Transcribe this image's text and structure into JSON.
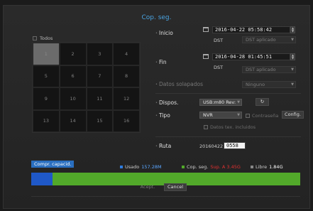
{
  "title": "Cop. seg.",
  "all_label": "Todos",
  "channels": [
    "1",
    "2",
    "3",
    "4",
    "5",
    "6",
    "7",
    "8",
    "9",
    "10",
    "11",
    "12",
    "13",
    "14",
    "15",
    "16"
  ],
  "start": {
    "label": "Inicio",
    "datetime": "2016-04-22 05:58:42",
    "dst_label": "DST",
    "dst_value": "DST aplicado"
  },
  "end": {
    "label": "Fin",
    "datetime": "2016-04-28 01:45:51",
    "dst_label": "DST",
    "dst_value": "DST aplicado"
  },
  "overlap": {
    "label": "Datos solapados",
    "value": "Ninguno"
  },
  "device": {
    "label": "Dispos.",
    "value": "USB:m80 Rev:"
  },
  "type": {
    "label": "Tipo",
    "value": "NVR",
    "password_label": "Contraseña",
    "config_label": "Config.",
    "text_data_label": "Datos tex. incluidos"
  },
  "path": {
    "label": "Ruta",
    "prefix": "20160422",
    "value": "0558"
  },
  "capacity": {
    "button": "Compr. capacid.",
    "used_label": "Usado",
    "used_value": "157.28M",
    "backup_label": "Cop. seg.",
    "backup_value": "Sup. A 3.45G",
    "free_label": "Libre",
    "free_value": "1.84G",
    "used_fraction": 0.08,
    "backup_fraction": 0.92
  },
  "buttons": {
    "accept": "Acept.",
    "cancel": "Cancel"
  },
  "colors": {
    "accent": "#4aa3e0",
    "used": "#1f58c8",
    "backup": "#52a92a",
    "warning": "#e03030"
  }
}
